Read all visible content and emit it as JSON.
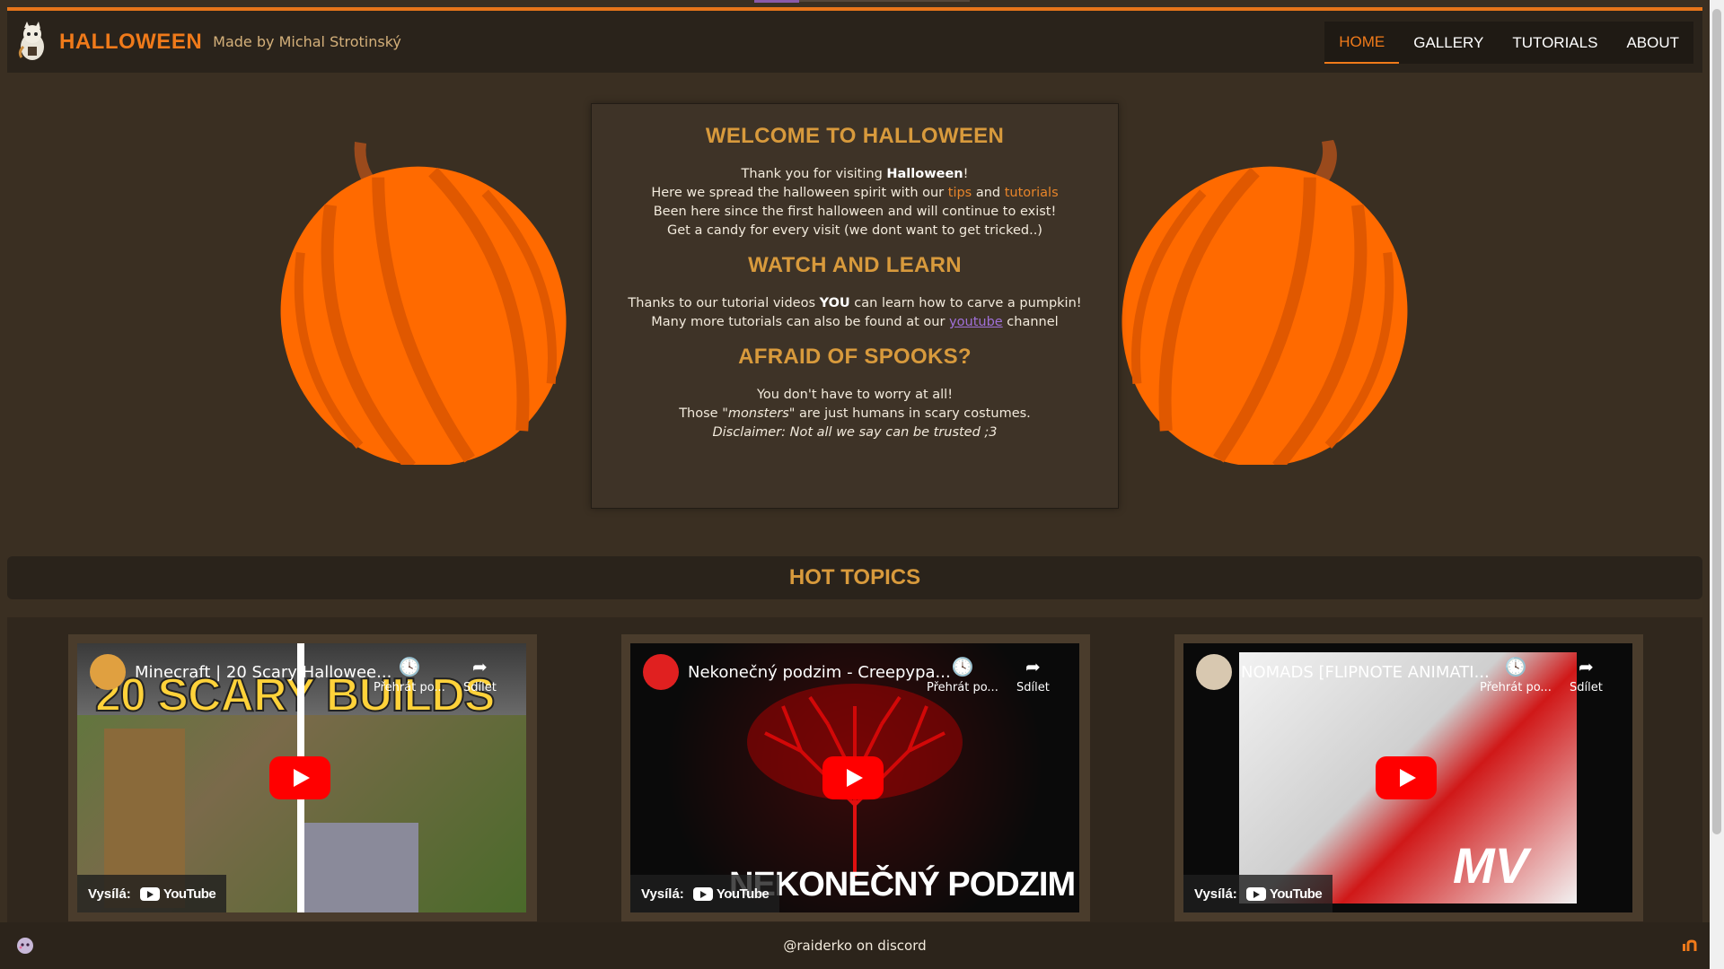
{
  "header": {
    "brand": "HALLOWEEN",
    "byline": "Made by Michal Strotinský",
    "nav": [
      "HOME",
      "GALLERY",
      "TUTORIALS",
      "ABOUT"
    ],
    "active_nav": "HOME"
  },
  "welcome": {
    "title": "WELCOME TO HALLOWEEN",
    "line1_pre": "Thank you for visiting ",
    "line1_bold": "Halloween",
    "line1_post": "!",
    "line2_pre": "Here we spread the halloween spirit with our ",
    "line2_link1": "tips",
    "line2_mid": " and ",
    "line2_link2": "tutorials",
    "line3": "Been here since the first halloween and will continue to exist!",
    "line4": "Get a candy for every visit (we dont want to get tricked..)",
    "learn_title": "WATCH AND LEARN",
    "learn1_pre": "Thanks to our tutorial videos ",
    "learn1_bold": "YOU",
    "learn1_post": " can learn how to carve a pumpkin!",
    "learn2_pre": "Many more tutorials can also be found at our ",
    "learn2_link": "youtube",
    "learn2_post": " channel",
    "spooks_title": "AFRAID OF SPOOKS?",
    "spooks1": "You don't have to worry at all!",
    "spooks2_pre": "Those \"",
    "spooks2_em": "monsters",
    "spooks2_post": "\" are just humans in scary costumes.",
    "spooks3": "Disclaimer: Not all we say can be trusted ;3"
  },
  "hot_topics": {
    "title": "HOT TOPICS",
    "videos": [
      {
        "title": "Minecraft | 20 Scary Hallowee...",
        "later": "Přehrát po...",
        "share": "Sdílet",
        "via": "Vysílá:",
        "yt": "YouTube",
        "overlay": "20 SCARY BUILDS"
      },
      {
        "title": "Nekonečný podzim - Creepypa...",
        "later": "Přehrát po...",
        "share": "Sdílet",
        "via": "Vysílá:",
        "yt": "YouTube",
        "overlay": "NEKONEČNÝ PODZIM"
      },
      {
        "title": "NOMADS [FLIPNOTE ANIMATI...",
        "later": "Přehrát po...",
        "share": "Sdílet",
        "via": "Vysílá:",
        "yt": "YouTube",
        "overlay": "MV"
      }
    ]
  },
  "footer": {
    "text": "@raiderko on discord"
  },
  "colors": {
    "accent": "#f07a1a",
    "heading": "#d89a3c",
    "background": "#3a2f22"
  }
}
